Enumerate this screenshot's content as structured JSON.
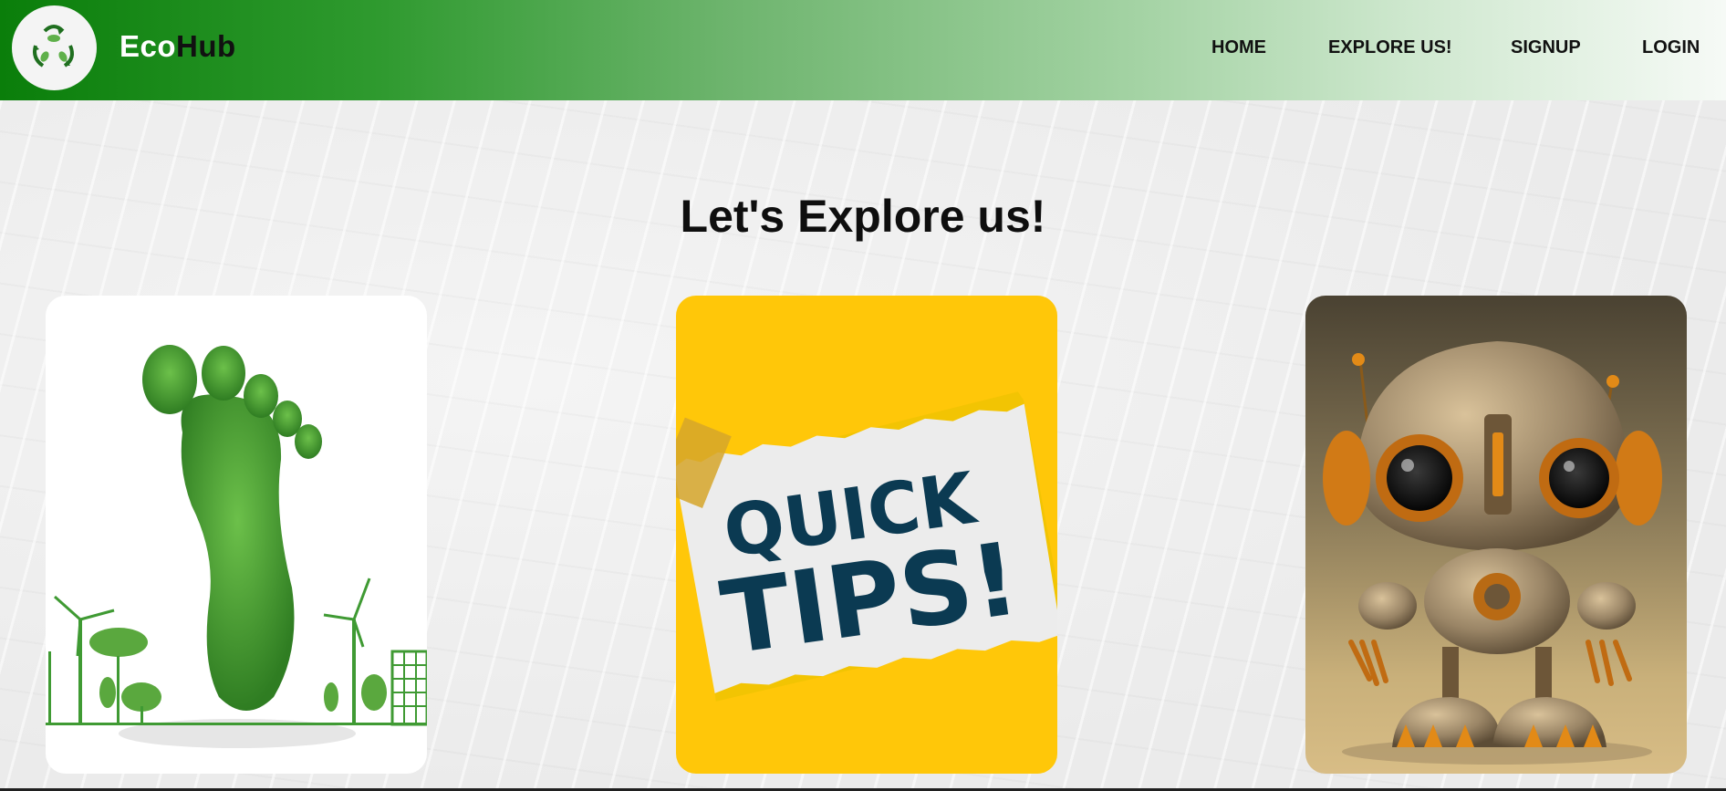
{
  "brand": {
    "part1": "Eco",
    "part2": "Hub",
    "logo_icon": "recycle-leaf-icon"
  },
  "nav": [
    "HOME",
    "EXPLORE US!",
    "SIGNUP",
    "LOGIN"
  ],
  "heading": "Let's Explore us!",
  "cards": [
    {
      "image": "green-footprint-wind-turbines"
    },
    {
      "image": "quick-tips-note",
      "line1": "QUICK",
      "line2": "TIPS!"
    },
    {
      "image": "orange-robot"
    }
  ],
  "colors": {
    "nav_green": "#0a7e0a",
    "tips_yellow": "#ffc709",
    "tips_text": "#0b3a52"
  }
}
